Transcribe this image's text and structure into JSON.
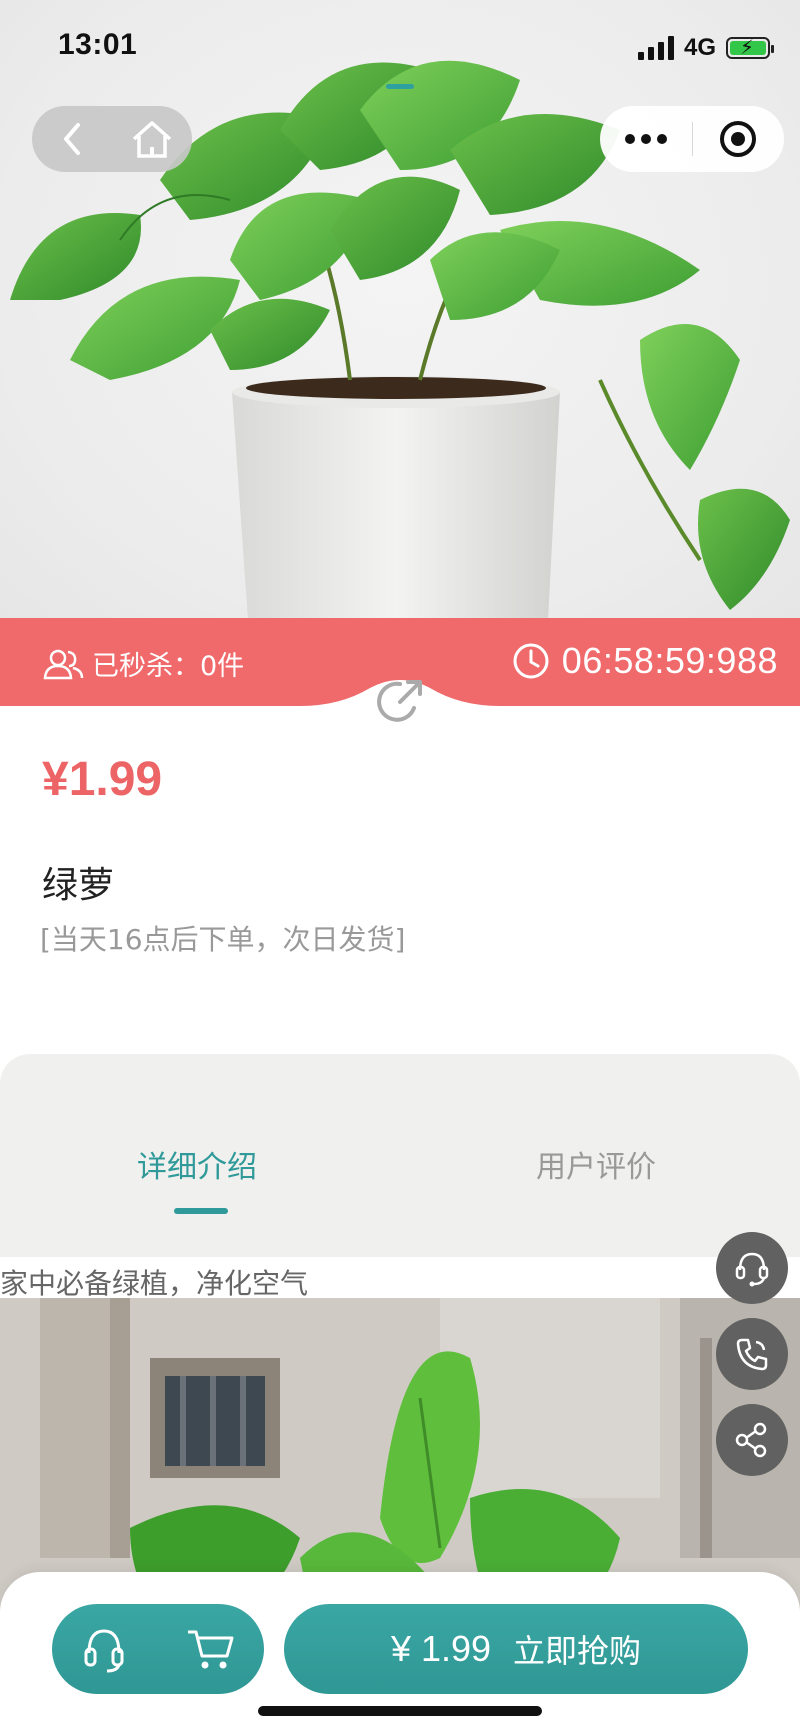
{
  "status_bar": {
    "time": "13:01",
    "network": "4G"
  },
  "nav": {
    "back_icon": "chevron-left-icon",
    "home_icon": "home-icon",
    "more_icon": "more-dots-icon",
    "target_icon": "target-icon"
  },
  "flash_sale": {
    "sold_label": "已秒杀：0件",
    "countdown": "06:58:59:988"
  },
  "product": {
    "price": "¥1.99",
    "name": "绿萝",
    "note": "[当天16点后下单，次日发货]"
  },
  "tabs": [
    {
      "label": "详细介绍",
      "active": true
    },
    {
      "label": "用户评价",
      "active": false
    }
  ],
  "detail": {
    "description": "家中必备绿植，净化空气"
  },
  "floating_buttons": [
    "customer-service-icon",
    "phone-icon",
    "share-icon"
  ],
  "bottom_bar": {
    "buy_price": "¥ 1.99",
    "buy_label": "立即抢购",
    "service_icon": "headset-icon",
    "cart_icon": "cart-icon"
  },
  "colors": {
    "accent": "#2f9a99",
    "flash": "#f06a6c",
    "price": "#ec6466"
  }
}
